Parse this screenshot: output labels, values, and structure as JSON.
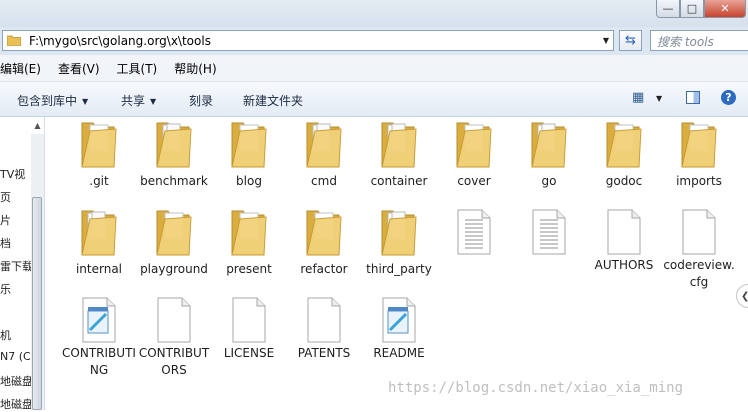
{
  "address": {
    "path": "F:\\mygo\\src\\golang.org\\x\\tools",
    "search_placeholder": "搜索 tools"
  },
  "menu": [
    "编辑(E)",
    "查看(V)",
    "工具(T)",
    "帮助(H)"
  ],
  "toolbar": {
    "include_library": "包含到库中",
    "share": "共享",
    "burn": "刻录",
    "new_folder": "新建文件夹"
  },
  "nav_items": [
    "TV视",
    "页",
    "片",
    "档",
    "雷下载",
    "乐",
    "机",
    "N7 (C",
    "地磁盘",
    "地磁盘"
  ],
  "items": [
    {
      "label": ".git",
      "type": "folder"
    },
    {
      "label": "benchmark",
      "type": "folder-full"
    },
    {
      "label": "blog",
      "type": "folder"
    },
    {
      "label": "cmd",
      "type": "folder-full"
    },
    {
      "label": "container",
      "type": "folder-full"
    },
    {
      "label": "cover",
      "type": "folder"
    },
    {
      "label": "go",
      "type": "folder-full"
    },
    {
      "label": "godoc",
      "type": "folder"
    },
    {
      "label": "imports",
      "type": "folder"
    },
    {
      "label": "internal",
      "type": "folder-full"
    },
    {
      "label": "playground",
      "type": "folder"
    },
    {
      "label": "present",
      "type": "folder"
    },
    {
      "label": "refactor",
      "type": "folder"
    },
    {
      "label": "third_party",
      "type": "folder-full"
    },
    {
      "label": "",
      "type": "text-file"
    },
    {
      "label": "",
      "type": "text-file"
    },
    {
      "label": "AUTHORS",
      "type": "blank-file"
    },
    {
      "label": "codereview.cfg",
      "type": "blank-file"
    },
    {
      "label": "CONTRIBUTING",
      "type": "notepad-file"
    },
    {
      "label": "CONTRIBUTORS",
      "type": "blank-file"
    },
    {
      "label": "LICENSE",
      "type": "blank-file"
    },
    {
      "label": "PATENTS",
      "type": "blank-file"
    },
    {
      "label": "README",
      "type": "notepad-file"
    }
  ],
  "watermark": "https://blog.csdn.net/xiao_xia_ming",
  "colors": {
    "folder": "#f2d27a",
    "folder_dark": "#d9ad3f",
    "accent": "#2c6ac3"
  }
}
